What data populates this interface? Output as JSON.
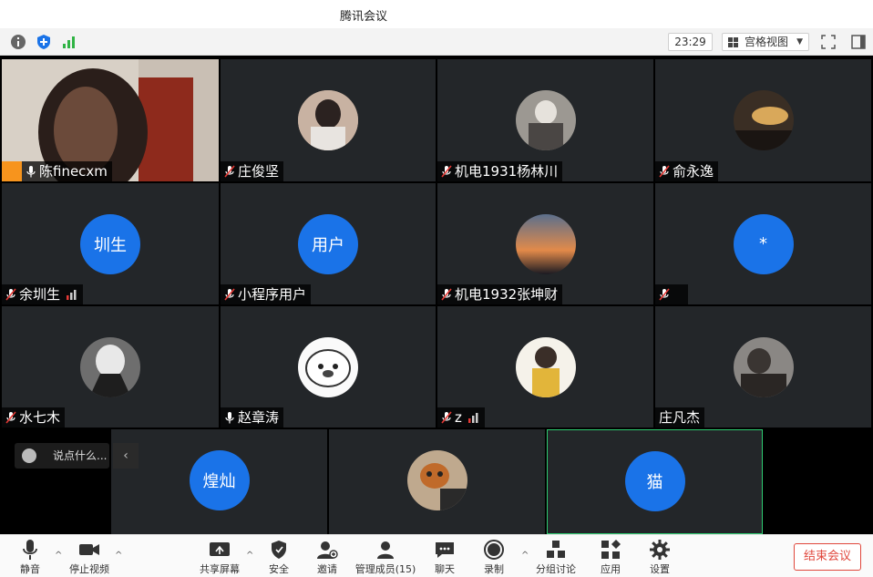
{
  "window": {
    "title": "腾讯会议"
  },
  "topbar": {
    "timer": "23:29",
    "view_mode": "宫格视图",
    "icons": [
      "info-icon",
      "shield-icon",
      "signal-icon",
      "fullscreen-icon",
      "sidebar-icon"
    ]
  },
  "participants": [
    {
      "name": "陈finecxm",
      "muted": false,
      "host": true,
      "avatar": "photo"
    },
    {
      "name": "庄俊坚",
      "muted": true,
      "avatar": "photo"
    },
    {
      "name": "机电1931杨林川",
      "muted": true,
      "avatar": "photo"
    },
    {
      "name": "俞永逸",
      "muted": true,
      "avatar": "photo"
    },
    {
      "name": "余圳生",
      "muted": true,
      "avatar_text": "圳生",
      "signal": true
    },
    {
      "name": "小程序用户",
      "muted": true,
      "avatar_text": "用户"
    },
    {
      "name": "机电1932张坤财",
      "muted": true,
      "avatar": "photo"
    },
    {
      "name": "",
      "muted": true,
      "avatar_text": "*"
    },
    {
      "name": "水七木",
      "muted": true,
      "avatar": "photo"
    },
    {
      "name": "赵章涛",
      "muted": false,
      "avatar": "photo"
    },
    {
      "name": "z",
      "muted": true,
      "avatar": "photo",
      "signal": true
    },
    {
      "name": "庄凡杰",
      "muted": false,
      "avatar": "photo"
    },
    {
      "name": "",
      "avatar_text": "煌灿"
    },
    {
      "name": "",
      "avatar": "photo"
    },
    {
      "name": "",
      "avatar_text": "猫",
      "active_speaker": true
    }
  ],
  "chat": {
    "placeholder": "说点什么..."
  },
  "toolbar": {
    "mute": "静音",
    "stop_video": "停止视频",
    "share_screen": "共享屏幕",
    "security": "安全",
    "invite": "邀请",
    "manage_members": "管理成员(15)",
    "chat": "聊天",
    "record": "录制",
    "breakout": "分组讨论",
    "apps": "应用",
    "settings": "设置",
    "end_meeting": "结束会议"
  },
  "colors": {
    "accent_blue": "#1a73e8",
    "end_red": "#e0473c",
    "host_orange": "#f7941d",
    "speaker_green": "#2ecc71"
  }
}
